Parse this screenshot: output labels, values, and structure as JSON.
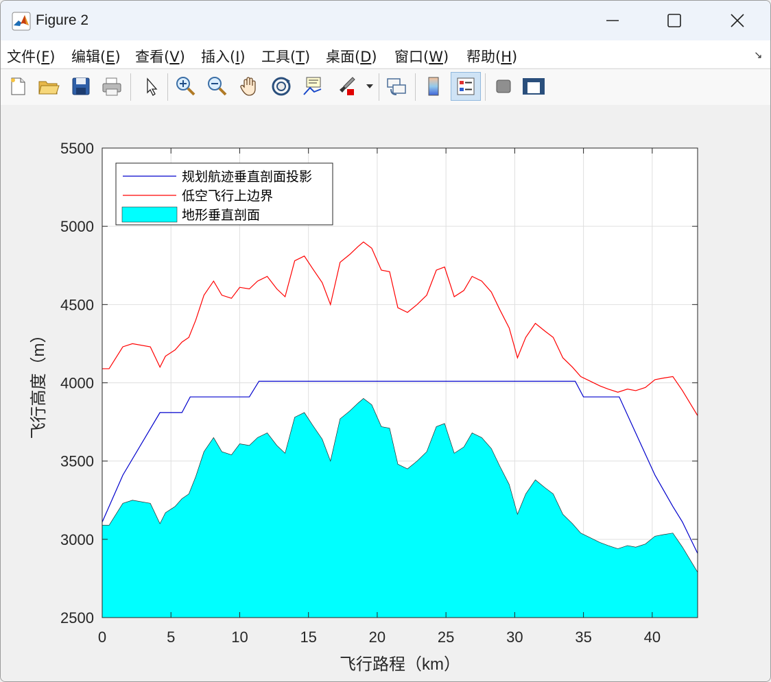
{
  "window": {
    "title": "Figure 2",
    "controls": {
      "minimize": "–",
      "maximize": "☐",
      "close": "✕"
    }
  },
  "menu": {
    "items": [
      {
        "label": "文件(",
        "key": "F",
        "suffix": ")"
      },
      {
        "label": "编辑(",
        "key": "E",
        "suffix": ")"
      },
      {
        "label": "查看(",
        "key": "V",
        "suffix": ")"
      },
      {
        "label": "插入(",
        "key": "I",
        "suffix": ")"
      },
      {
        "label": "工具(",
        "key": "T",
        "suffix": ")"
      },
      {
        "label": "桌面(",
        "key": "D",
        "suffix": ")"
      },
      {
        "label": "窗口(",
        "key": "W",
        "suffix": ")"
      },
      {
        "label": "帮助(",
        "key": "H",
        "suffix": ")"
      }
    ],
    "undock_icon": "↘"
  },
  "toolbar": {
    "buttons": [
      "new-figure-icon",
      "open-file-icon",
      "save-icon",
      "print-icon",
      "select-arrow-icon",
      "zoom-in-icon",
      "zoom-out-icon",
      "pan-hand-icon",
      "rotate-3d-icon",
      "data-cursor-icon",
      "brush-icon",
      "link-plot-icon",
      "colorbar-icon",
      "legend-icon",
      "hide-plot-tools-icon",
      "show-plot-tools-icon"
    ],
    "active": "legend-icon"
  },
  "chart_data": {
    "type": "line",
    "xlabel": "飞行路程（km）",
    "ylabel": "飞行高度（m）",
    "xlim": [
      0,
      43.3
    ],
    "ylim": [
      2500,
      5500
    ],
    "xticks": [
      0,
      5,
      10,
      15,
      20,
      25,
      30,
      35,
      40
    ],
    "yticks": [
      2500,
      3000,
      3500,
      4000,
      4500,
      5000,
      5500
    ],
    "grid": true,
    "legend_position": "top-left",
    "colors": {
      "planned": "#0000cc",
      "upper": "#ff0000",
      "terrain": "#00ffff"
    },
    "series": [
      {
        "name": "规划航迹垂直剖面投影",
        "style": "line",
        "x": [
          0,
          1.5,
          4.2,
          5.8,
          6.4,
          10.7,
          11.4,
          34.4,
          35,
          37.6,
          40.2,
          41.5,
          42.2,
          43.3
        ],
        "y": [
          3110,
          3410,
          3810,
          3810,
          3910,
          3910,
          4010,
          4010,
          3910,
          3910,
          3410,
          3210,
          3110,
          2910
        ]
      },
      {
        "name": "低空飞行上边界",
        "style": "line",
        "x": [
          0,
          0.5,
          1.5,
          2.2,
          3.5,
          4.2,
          4.6,
          5.3,
          5.8,
          6.3,
          6.8,
          7.4,
          8.1,
          8.7,
          9.4,
          10,
          10.7,
          11.3,
          12,
          12.7,
          13.3,
          14,
          14.7,
          15.3,
          16.0,
          16.6,
          17.3,
          18.0,
          18.6,
          19.0,
          19.6,
          20.3,
          20.9,
          21.5,
          22.2,
          22.9,
          23.6,
          24.3,
          24.9,
          25.6,
          26.3,
          26.9,
          27.6,
          28.3,
          28.9,
          29.6,
          30.2,
          30.8,
          31.5,
          32.2,
          32.8,
          33.5,
          34.2,
          34.8,
          35.5,
          36.2,
          36.8,
          37.5,
          38.2,
          38.8,
          39.5,
          40.2,
          40.8,
          41.5,
          42.2,
          43.3
        ],
        "y": [
          4090,
          4090,
          4230,
          4250,
          4230,
          4100,
          4170,
          4210,
          4260,
          4290,
          4400,
          4560,
          4650,
          4560,
          4540,
          4610,
          4600,
          4650,
          4680,
          4600,
          4550,
          4780,
          4810,
          4730,
          4640,
          4500,
          4770,
          4820,
          4870,
          4900,
          4860,
          4720,
          4710,
          4480,
          4450,
          4500,
          4560,
          4720,
          4740,
          4550,
          4590,
          4680,
          4650,
          4580,
          4470,
          4350,
          4160,
          4290,
          4380,
          4330,
          4290,
          4160,
          4100,
          4040,
          4010,
          3980,
          3960,
          3940,
          3960,
          3950,
          3970,
          4020,
          4030,
          4040,
          3950,
          3790
        ]
      },
      {
        "name": "地形垂直剖面",
        "style": "area",
        "x": [
          0,
          0.5,
          1.5,
          2.2,
          3.5,
          4.2,
          4.6,
          5.3,
          5.8,
          6.3,
          6.8,
          7.4,
          8.1,
          8.7,
          9.4,
          10,
          10.7,
          11.3,
          12,
          12.7,
          13.3,
          14,
          14.7,
          15.3,
          16.0,
          16.6,
          17.3,
          18.0,
          18.6,
          19.0,
          19.6,
          20.3,
          20.9,
          21.5,
          22.2,
          22.9,
          23.6,
          24.3,
          24.9,
          25.6,
          26.3,
          26.9,
          27.6,
          28.3,
          28.9,
          29.6,
          30.2,
          30.8,
          31.5,
          32.2,
          32.8,
          33.5,
          34.2,
          34.8,
          35.5,
          36.2,
          36.8,
          37.5,
          38.2,
          38.8,
          39.5,
          40.2,
          40.8,
          41.5,
          42.2,
          43.3
        ],
        "y": [
          3090,
          3090,
          3230,
          3250,
          3230,
          3100,
          3170,
          3210,
          3260,
          3290,
          3400,
          3560,
          3650,
          3560,
          3540,
          3610,
          3600,
          3650,
          3680,
          3600,
          3550,
          3780,
          3810,
          3730,
          3640,
          3500,
          3770,
          3820,
          3870,
          3900,
          3860,
          3720,
          3710,
          3480,
          3450,
          3500,
          3560,
          3720,
          3740,
          3550,
          3590,
          3680,
          3650,
          3580,
          3470,
          3350,
          3160,
          3290,
          3380,
          3330,
          3290,
          3160,
          3100,
          3040,
          3010,
          2980,
          2960,
          2940,
          2960,
          2950,
          2970,
          3020,
          3030,
          3040,
          2950,
          2790
        ]
      }
    ]
  }
}
